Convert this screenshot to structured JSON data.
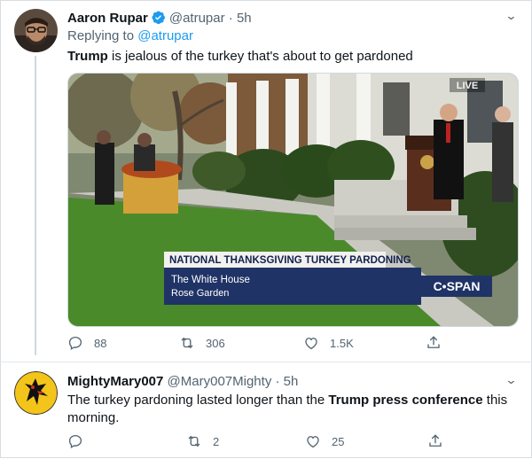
{
  "tweet1": {
    "name": "Aaron Rupar",
    "handle": "@atrupar",
    "time": "5h",
    "replying_prefix": "Replying to",
    "replying_handle": "@atrupar",
    "text_bold": "Trump",
    "text_rest": " is jealous of the turkey that's about to get pardoned",
    "video": {
      "live_badge": "LIVE",
      "banner_title": "NATIONAL THANKSGIVING TURKEY PARDONING",
      "banner_line1": "The White House",
      "banner_line2": "Rose Garden",
      "channel_logo": "C•SPAN"
    },
    "actions": {
      "replies": "88",
      "retweets": "306",
      "likes": "1.5K"
    }
  },
  "tweet2": {
    "name": "MightyMary007",
    "handle": "@Mary007Mighty",
    "time": "5h",
    "text_1": "The turkey pardoning lasted longer than the ",
    "text_bold": "Trump press conference",
    "text_2": " this morning.",
    "actions": {
      "replies": "",
      "retweets": "2",
      "likes": "25"
    }
  },
  "colors": {
    "accent": "#1d9bf0",
    "muted": "#536471",
    "text": "#0f1419"
  },
  "icons": [
    "verified-badge-icon",
    "chevron-down-icon",
    "reply-icon",
    "retweet-icon",
    "like-icon",
    "share-icon",
    "play-video-icon"
  ]
}
